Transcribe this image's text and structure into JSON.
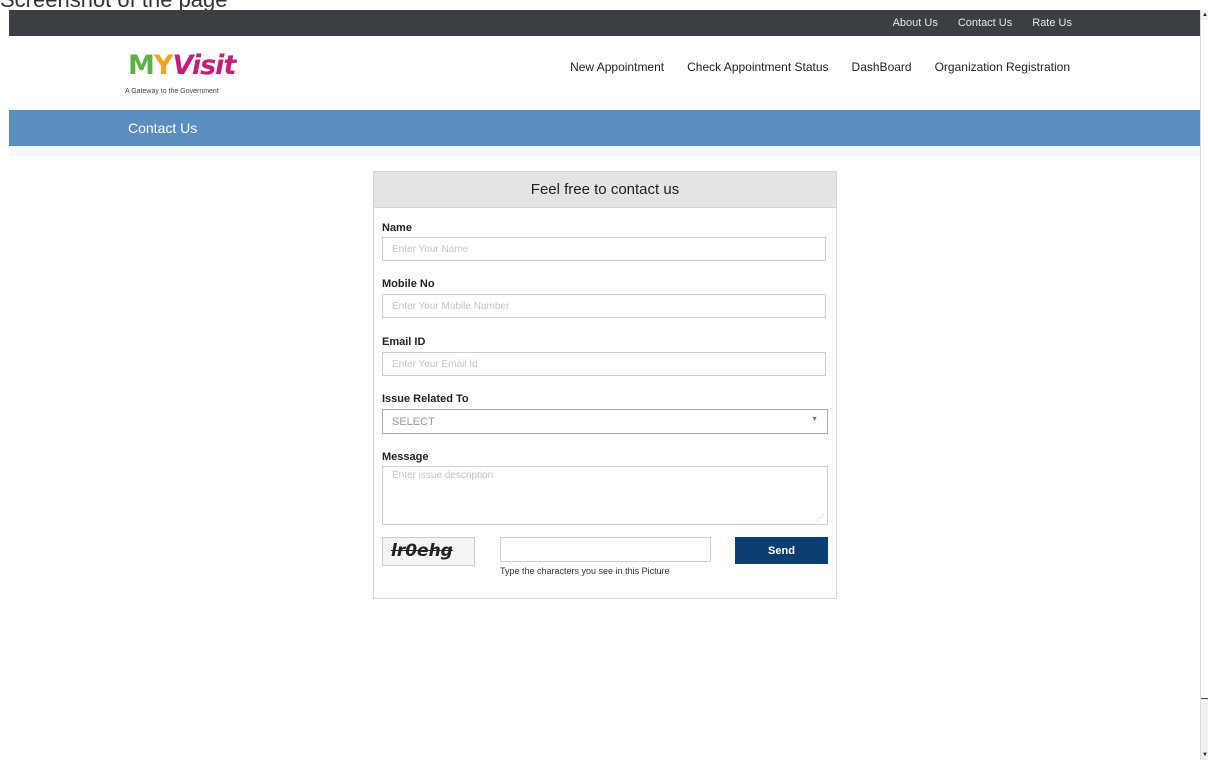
{
  "window": {
    "title": "Screenshot of the page"
  },
  "topbar": {
    "links": [
      "About Us",
      "Contact Us",
      "Rate Us"
    ]
  },
  "logo": {
    "m": "M",
    "y": "Y",
    "visit": "Visit",
    "tagline": "A Gateway to the Government",
    "colors": {
      "m": "#5db043",
      "y": "#f3a321",
      "visit": "#c41e7a"
    }
  },
  "nav": {
    "items": [
      "New Appointment",
      "Check Appointment Status",
      "DashBoard",
      "Organization Registration"
    ]
  },
  "pagebar": {
    "title": "Contact Us",
    "color": "#5a8ebf"
  },
  "form": {
    "heading": "Feel free to contact us",
    "name": {
      "label": "Name",
      "placeholder": "Enter Your Name"
    },
    "mobile": {
      "label": "Mobile No",
      "placeholder": "Enter Your Mobile Number"
    },
    "email": {
      "label": "Email ID",
      "placeholder": "Enter Your Email Id"
    },
    "issue": {
      "label": "Issue Related To",
      "selected": "SELECT"
    },
    "message": {
      "label": "Message",
      "placeholder": "Enter issue description"
    },
    "captcha": {
      "code": "lr0ehg",
      "help": "Type the characters you see in this Picture"
    },
    "send_label": "Send",
    "send_color": "#0b3f74"
  },
  "icons": {
    "dropdown": "triangle-down",
    "resize": "resize-grip",
    "scroll_up": "up-arrow",
    "scroll_down": "down-arrow"
  }
}
